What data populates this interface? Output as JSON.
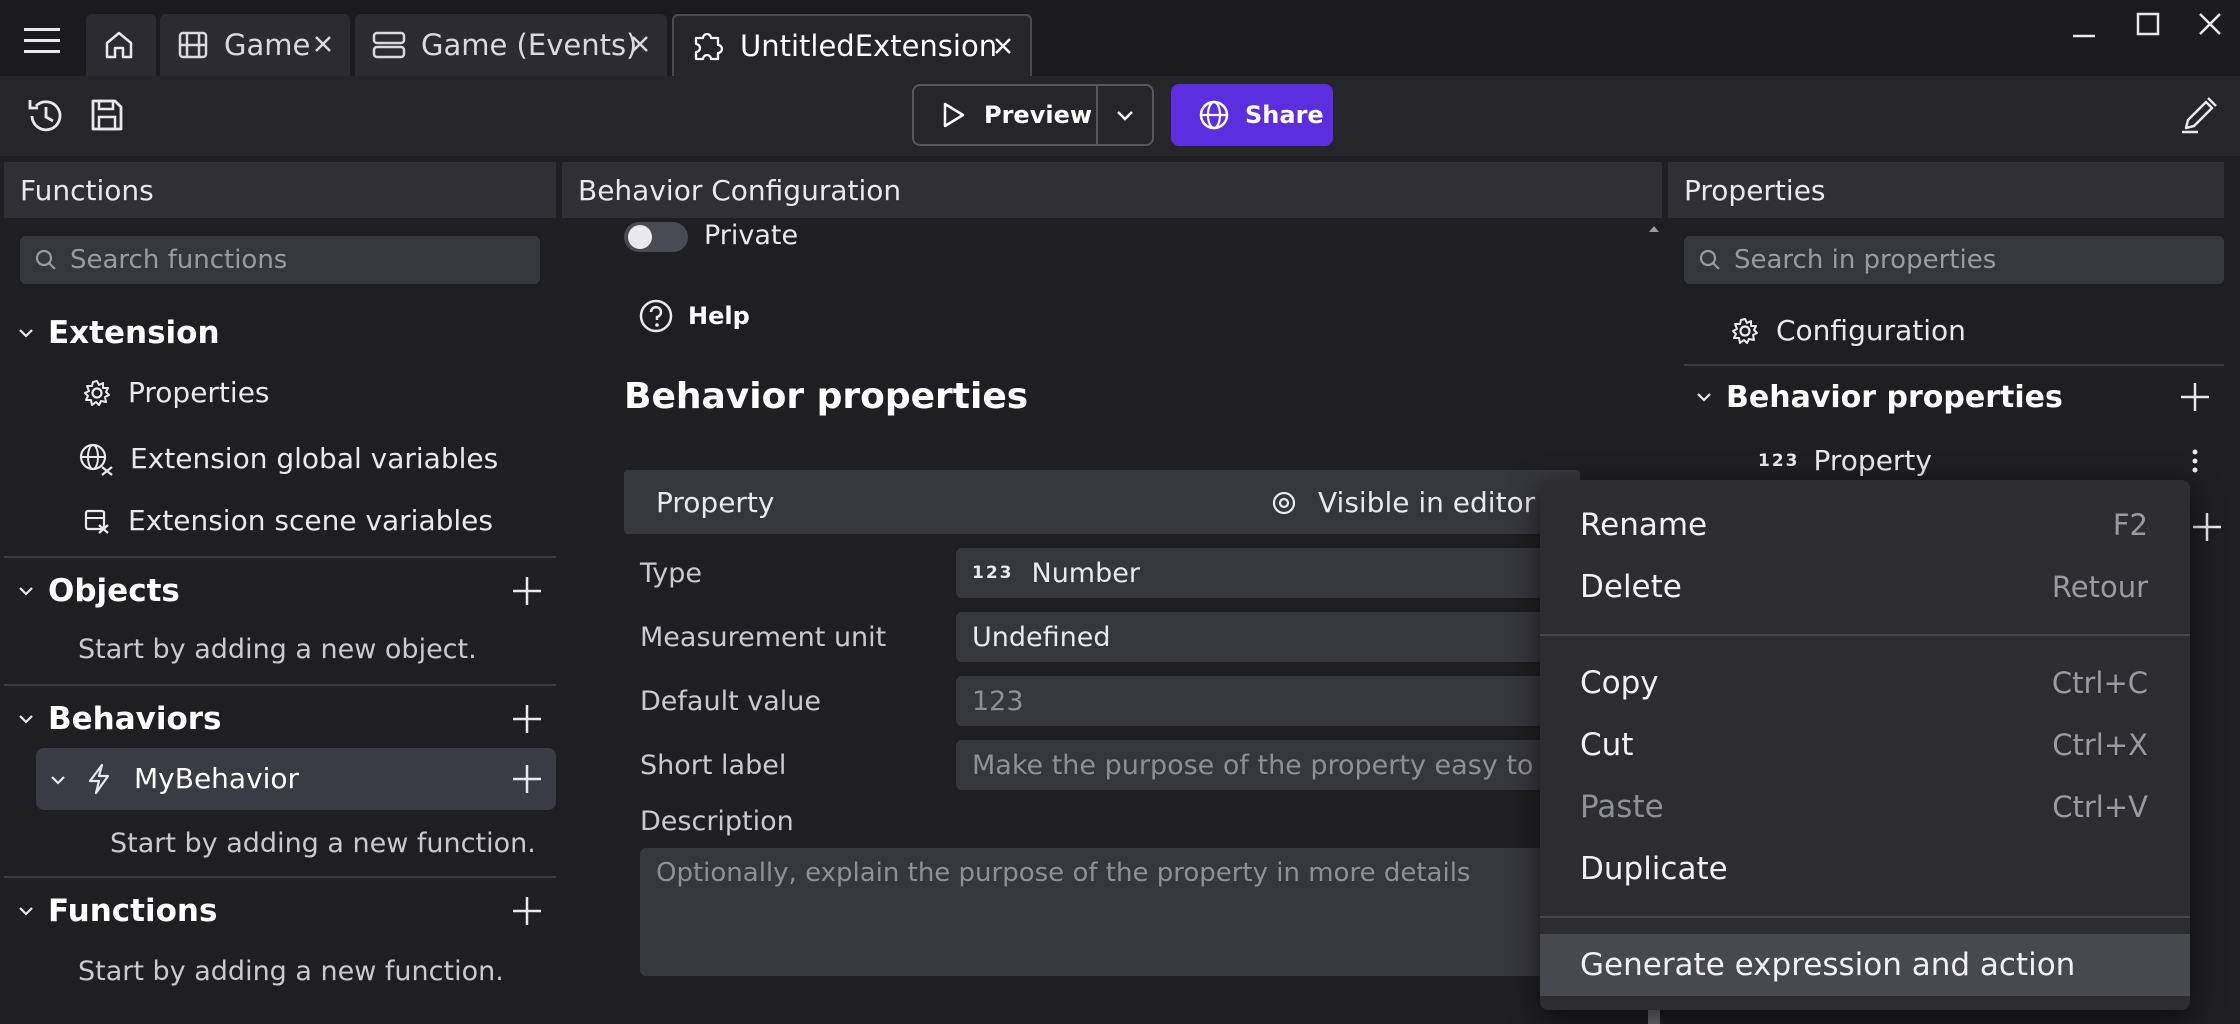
{
  "tabs": [
    {
      "label": "",
      "icon": "home-icon"
    },
    {
      "label": "Game",
      "icon": "film-icon"
    },
    {
      "label": "Game (Events)",
      "icon": "events-icon"
    },
    {
      "label": "UntitledExtension",
      "icon": "puzzle-icon",
      "active": true
    }
  ],
  "toolbar": {
    "preview_label": "Preview",
    "share_label": "Share"
  },
  "left": {
    "header": "Functions",
    "search_placeholder": "Search functions",
    "extension": {
      "title": "Extension",
      "items": [
        "Properties",
        "Extension global variables",
        "Extension scene variables"
      ]
    },
    "objects": {
      "title": "Objects",
      "empty": "Start by adding a new object."
    },
    "behaviors": {
      "title": "Behaviors",
      "item": "MyBehavior",
      "empty": "Start by adding a new function."
    },
    "functions": {
      "title": "Functions",
      "empty": "Start by adding a new function."
    }
  },
  "center": {
    "header": "Behavior Configuration",
    "private_label": "Private",
    "help_label": "Help",
    "section_title": "Behavior properties",
    "property": {
      "name": "Property",
      "visibility": "Visible in editor",
      "type_label": "Type",
      "type_badge": "123",
      "type_value": "Number",
      "unit_label": "Measurement unit",
      "unit_value": "Undefined",
      "default_label": "Default value",
      "default_placeholder": "123",
      "short_label": "Short label",
      "short_placeholder": "Make the purpose of the property easy to und",
      "description_label": "Description",
      "description_placeholder": "Optionally, explain the purpose of the property in more details"
    }
  },
  "right": {
    "header": "Properties",
    "search_placeholder": "Search in properties",
    "configuration": "Configuration",
    "section": "Behavior properties",
    "property_badge": "123",
    "property_name": "Property"
  },
  "context_menu": {
    "items": [
      {
        "label": "Rename",
        "shortcut": "F2"
      },
      {
        "label": "Delete",
        "shortcut": "Retour"
      },
      {
        "label": "Copy",
        "shortcut": "Ctrl+C"
      },
      {
        "label": "Cut",
        "shortcut": "Ctrl+X"
      },
      {
        "label": "Paste",
        "shortcut": "Ctrl+V",
        "disabled": true
      },
      {
        "label": "Duplicate",
        "shortcut": ""
      },
      {
        "label": "Generate expression and action",
        "shortcut": "",
        "highlighted": true
      }
    ]
  },
  "colors": {
    "accent": "#5b2fe0",
    "background": "#1f1f23",
    "panel_header": "#2f2f35",
    "selected_row": "#3b3b43"
  }
}
